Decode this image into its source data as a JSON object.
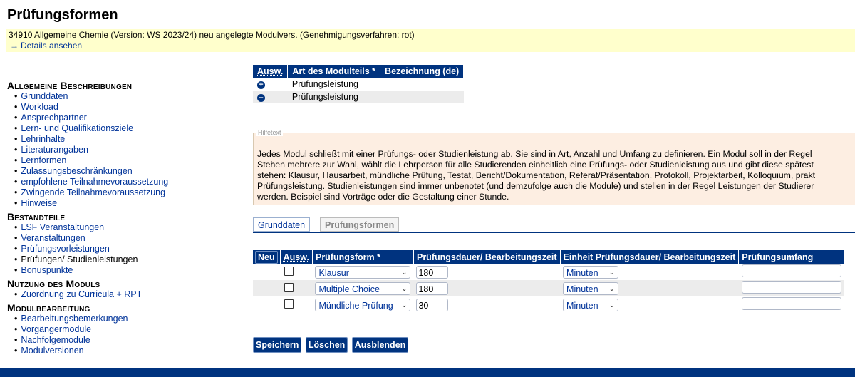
{
  "page": {
    "title": "Prüfungsformen"
  },
  "info": {
    "line": "34910  Allgemeine Chemie  (Version: WS 2023/24)  neu angelegte Modulvers.  (Genehmigungsverfahren: rot)",
    "details_link": "Details ansehen"
  },
  "sidebar": {
    "sections": [
      {
        "heading": "Allgemeine Beschreibungen",
        "items": [
          "Grunddaten",
          "Workload",
          "Ansprechpartner",
          "Lern- und Qualifikationsziele",
          "Lehrinhalte",
          "Literaturangaben",
          "Lernformen",
          "Zulassungsbeschränkungen",
          "empfohlene Teilnahmevoraussetzung",
          "Zwingende Teilnahmevoraussetzung",
          "Hinweise"
        ]
      },
      {
        "heading": "Bestandteile",
        "items": [
          "LSF Veranstaltungen",
          "Veranstaltungen",
          "Prüfungsvorleistungen",
          "Prüfungen/ Studienleistungen",
          "Bonuspunkte"
        ]
      },
      {
        "heading": "Nutzung des Moduls",
        "items": [
          "Zuordnung zu Curricula + RPT"
        ]
      },
      {
        "heading": "Modulbearbeitung",
        "items": [
          "Bearbeitungsbemerkungen",
          "Vorgängermodule",
          "Nachfolgemodule",
          "Modulversionen"
        ]
      }
    ]
  },
  "modulteile": {
    "headers": [
      "Ausw.",
      "Art des Modulteils *",
      "Bezeichnung (de)"
    ],
    "rows": [
      {
        "icon": "plus-circle-icon",
        "art": "Prüfungsleistung",
        "bez": ""
      },
      {
        "icon": "minus-circle-icon",
        "art": "Prüfungsleistung",
        "bez": ""
      }
    ]
  },
  "help": {
    "legend": "Hilfetext",
    "lines": [
      "Jedes Modul schließt mit einer Prüfungs- oder Studienleistung ab. Sie sind in Art, Anzahl und Umfang zu definieren. Ein Modul soll in der Regel",
      "Stehen mehrere zur Wahl, wählt die Lehrperson für alle Studierenden einheitlich eine Prüfungs- oder Studienleistung aus und gibt diese spätest",
      "stehen: Klausur, Hausarbeit, mündliche Prüfung, Testat, Bericht/Dokumentation, Referat/Präsentation, Protokoll, Projektarbeit, Kolloquium, prakt",
      "Prüfungsleistung. Studienleistungen sind immer unbenotet (und demzufolge auch die Module) und stellen in der Regel Leistungen der Studierer",
      "werden. Beispiel sind Vorträge oder die Gestaltung einer Stunde."
    ]
  },
  "tabs": {
    "grunddaten": "Grunddaten",
    "pruefungsformen": "Prüfungsformen"
  },
  "pruefungsformen": {
    "neu_label": "Neu",
    "headers": [
      "Ausw.",
      "Prüfungsform *",
      "Prüfungsdauer/ Bearbeitungszeit",
      "Einheit Prüfungsdauer/ Bearbeitungszeit",
      "Prüfungsumfang"
    ],
    "rows": [
      {
        "form": "Klausur",
        "dauer": "180",
        "einheit": "Minuten",
        "umfang": ""
      },
      {
        "form": "Multiple Choice",
        "dauer": "180",
        "einheit": "Minuten",
        "umfang": ""
      },
      {
        "form": "Mündliche Prüfung",
        "dauer": "30",
        "einheit": "Minuten",
        "umfang": ""
      }
    ]
  },
  "buttons": {
    "save": "Speichern",
    "delete": "Löschen",
    "hide": "Ausblenden"
  },
  "colors": {
    "header_blue": "#00337f",
    "info_yellow": "#ffffcc",
    "help_bg": "#fdeee2",
    "link": "#003399"
  }
}
